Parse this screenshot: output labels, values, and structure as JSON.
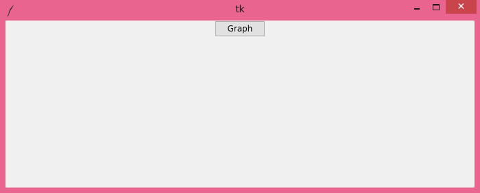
{
  "window": {
    "title": "tk",
    "app_icon": "feather-icon",
    "controls": {
      "minimize_icon": "minimize-icon",
      "maximize_icon": "maximize-icon",
      "close_label": "✕"
    },
    "colors": {
      "frame": "#e9658f",
      "close_button": "#c9444b",
      "client_background": "#f0f0f0"
    }
  },
  "main": {
    "graph_button_label": "Graph"
  }
}
